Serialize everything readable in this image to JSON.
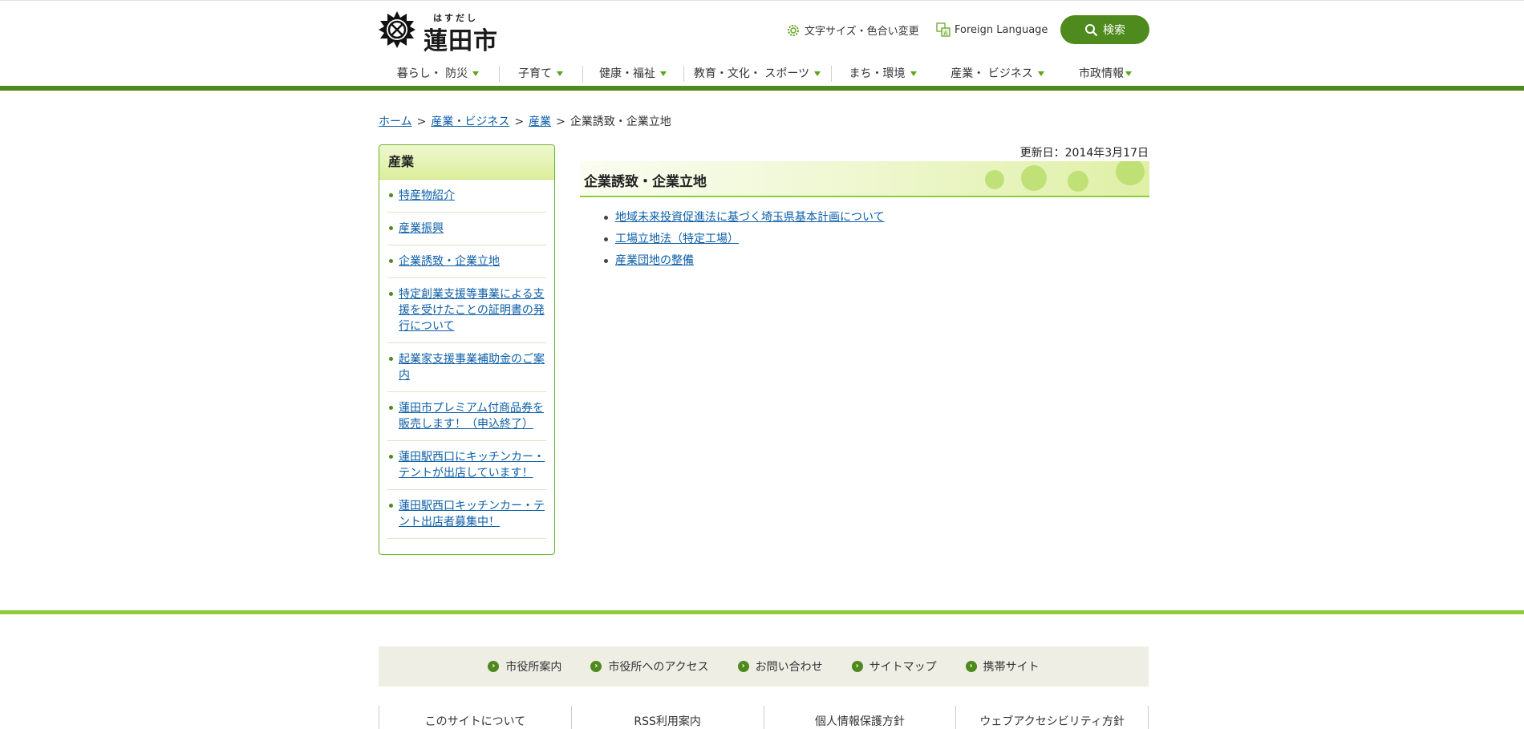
{
  "header": {
    "logo_ruby": "はすだし",
    "logo_name": "蓮田市",
    "text_size_label": "文字サイズ・色合い変更",
    "foreign_language_label": "Foreign Language",
    "search_label": "検索"
  },
  "gnav": [
    {
      "label": "暮らし・ 防災"
    },
    {
      "label": "子育て"
    },
    {
      "label": "健康・福祉"
    },
    {
      "label": "教育・文化・ スポーツ"
    },
    {
      "label": "まち・環境"
    },
    {
      "label": "産業・ ビジネス"
    },
    {
      "label": "市政情報"
    }
  ],
  "breadcrumb": {
    "home": "ホーム",
    "level1": "産業・ビジネス",
    "level2": "産業",
    "current": "企業誘致・企業立地",
    "separator": ">"
  },
  "sidebar": {
    "title": "産業",
    "items": [
      "特産物紹介",
      "産業振興",
      "企業誘致・企業立地",
      "特定創業支援等事業による支援を受けたことの証明書の発行について",
      "起業家支援事業補助金のご案内",
      "蓮田市プレミアム付商品券を販売します！（申込終了）",
      "蓮田駅西口にキッチンカー・テントが出店しています！",
      "蓮田駅西口キッチンカー・テント出店者募集中！"
    ]
  },
  "main": {
    "updated": "更新日：2014年3月17日",
    "title": "企業誘致・企業立地",
    "links": [
      "地域未来投資促進法に基づく埼玉県基本計画について",
      "工場立地法（特定工場）",
      "産業団地の整備"
    ]
  },
  "footer": {
    "nav": [
      "市役所案内",
      "市役所へのアクセス",
      "お問い合わせ",
      "サイトマップ",
      "携帯サイト"
    ],
    "links": [
      "このサイトについて",
      "RSS利用案内",
      "個人情報保護方針",
      "ウェブアクセシビリティ方針"
    ]
  },
  "colors": {
    "brand_green": "#4e8a1d",
    "accent_green": "#8fcc3a",
    "link_blue": "#0d5fa8"
  }
}
